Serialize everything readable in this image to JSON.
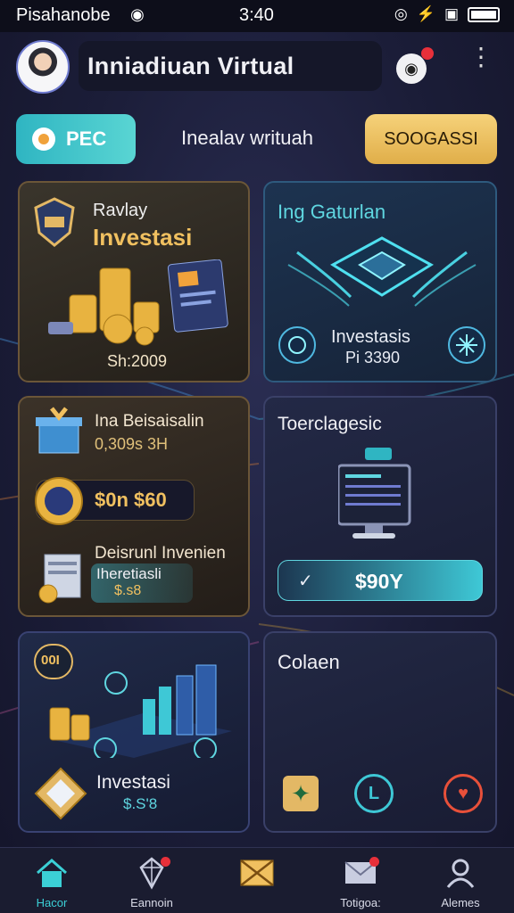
{
  "status_bar": {
    "carrier": "Pisahanobe",
    "time": "3:40"
  },
  "header": {
    "title": "Inniadiuan Virtual"
  },
  "tabs": {
    "left_label": "PEC",
    "center_label": "Inealav writuah",
    "right_label": "SOOGASSI"
  },
  "cards": {
    "card1": {
      "kicker": "Ravlay",
      "title": "Investasi",
      "value": "Sh:2009"
    },
    "card2": {
      "title": "Ing Gaturlan",
      "subtitle": "Investasis",
      "value": "Pi 3390"
    },
    "card3": {
      "title": "Ina Beisaisalin",
      "subvalue": "0,309s 3H",
      "amount": "$0n $60",
      "item_title": "Deisrunl Invenien",
      "item_sub": "Iheretiasli",
      "item_value": "$.s8"
    },
    "card4": {
      "title": "Toerclagesic",
      "button_label": "$90Y"
    },
    "card5": {
      "badge": "00I",
      "title": "Investasi",
      "value": "$.S'8"
    },
    "card6": {
      "title": "Colaen"
    }
  },
  "bottom_nav": {
    "items": [
      {
        "label": "Hacor",
        "icon": "home-icon",
        "active": true
      },
      {
        "label": "Eannoin",
        "icon": "diamond-icon",
        "active": false
      },
      {
        "label": "",
        "icon": "envelope-gold-icon",
        "active": false
      },
      {
        "label": "Totigoa:",
        "icon": "mail-icon",
        "active": false
      },
      {
        "label": "Alemes",
        "icon": "user-icon",
        "active": false
      }
    ]
  },
  "colors": {
    "accent": "#3bd0d6",
    "gold": "#f0c060",
    "notification": "#e8303a"
  }
}
